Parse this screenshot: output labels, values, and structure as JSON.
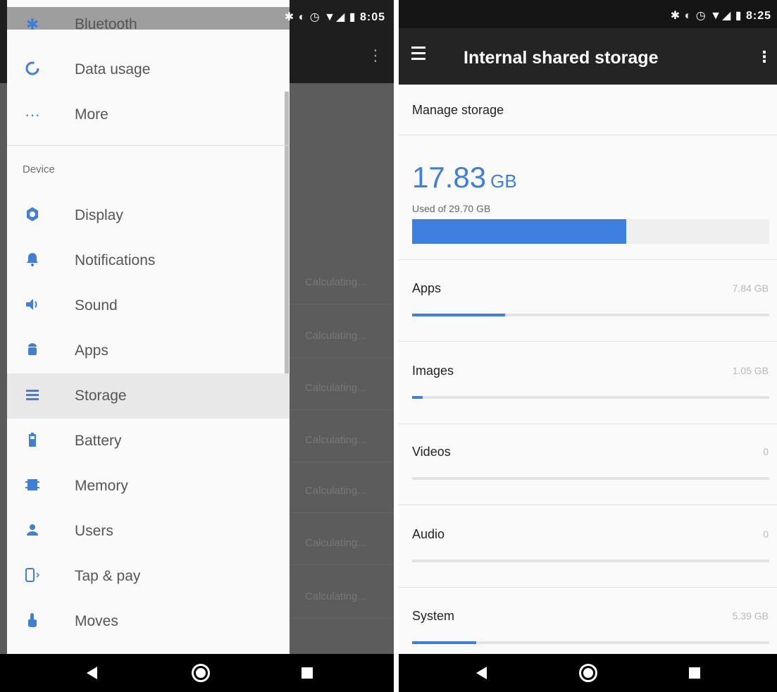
{
  "left": {
    "status_time": "8:05",
    "background_rows": [
      "Calculating...",
      "Calculating...",
      "Calculating...",
      "Calculating...",
      "Calculating...",
      "Calculating...",
      "Calculating..."
    ],
    "drawer": {
      "items_top": [
        {
          "label": "Bluetooth",
          "icon": "bluetooth-icon"
        },
        {
          "label": "Data usage",
          "icon": "data-usage-icon"
        },
        {
          "label": "More",
          "icon": "more-horiz-icon"
        }
      ],
      "section_label": "Device",
      "items": [
        {
          "label": "Display",
          "icon": "display-icon"
        },
        {
          "label": "Notifications",
          "icon": "bell-icon"
        },
        {
          "label": "Sound",
          "icon": "volume-icon"
        },
        {
          "label": "Apps",
          "icon": "android-icon"
        },
        {
          "label": "Storage",
          "icon": "storage-icon",
          "selected": true
        },
        {
          "label": "Battery",
          "icon": "battery-icon"
        },
        {
          "label": "Memory",
          "icon": "memory-icon"
        },
        {
          "label": "Users",
          "icon": "person-icon"
        },
        {
          "label": "Tap & pay",
          "icon": "tap-pay-icon"
        },
        {
          "label": "Moves",
          "icon": "gesture-icon"
        }
      ]
    }
  },
  "right": {
    "status_time": "8:25",
    "toolbar_title": "Internal shared storage",
    "manage_storage": "Manage storage",
    "used_value": "17.83",
    "used_unit": "GB",
    "used_of": "Used of 29.70 GB",
    "used_fraction": 0.6,
    "categories": [
      {
        "name": "Apps",
        "size": "7.84 GB",
        "fraction": 0.26
      },
      {
        "name": "Images",
        "size": "1.05 GB",
        "fraction": 0.03
      },
      {
        "name": "Videos",
        "size": "0",
        "fraction": 0
      },
      {
        "name": "Audio",
        "size": "0",
        "fraction": 0
      },
      {
        "name": "System",
        "size": "5.39 GB",
        "fraction": 0.18
      }
    ]
  },
  "colors": {
    "accent": "#3d80e0",
    "toolbar": "#242424"
  }
}
